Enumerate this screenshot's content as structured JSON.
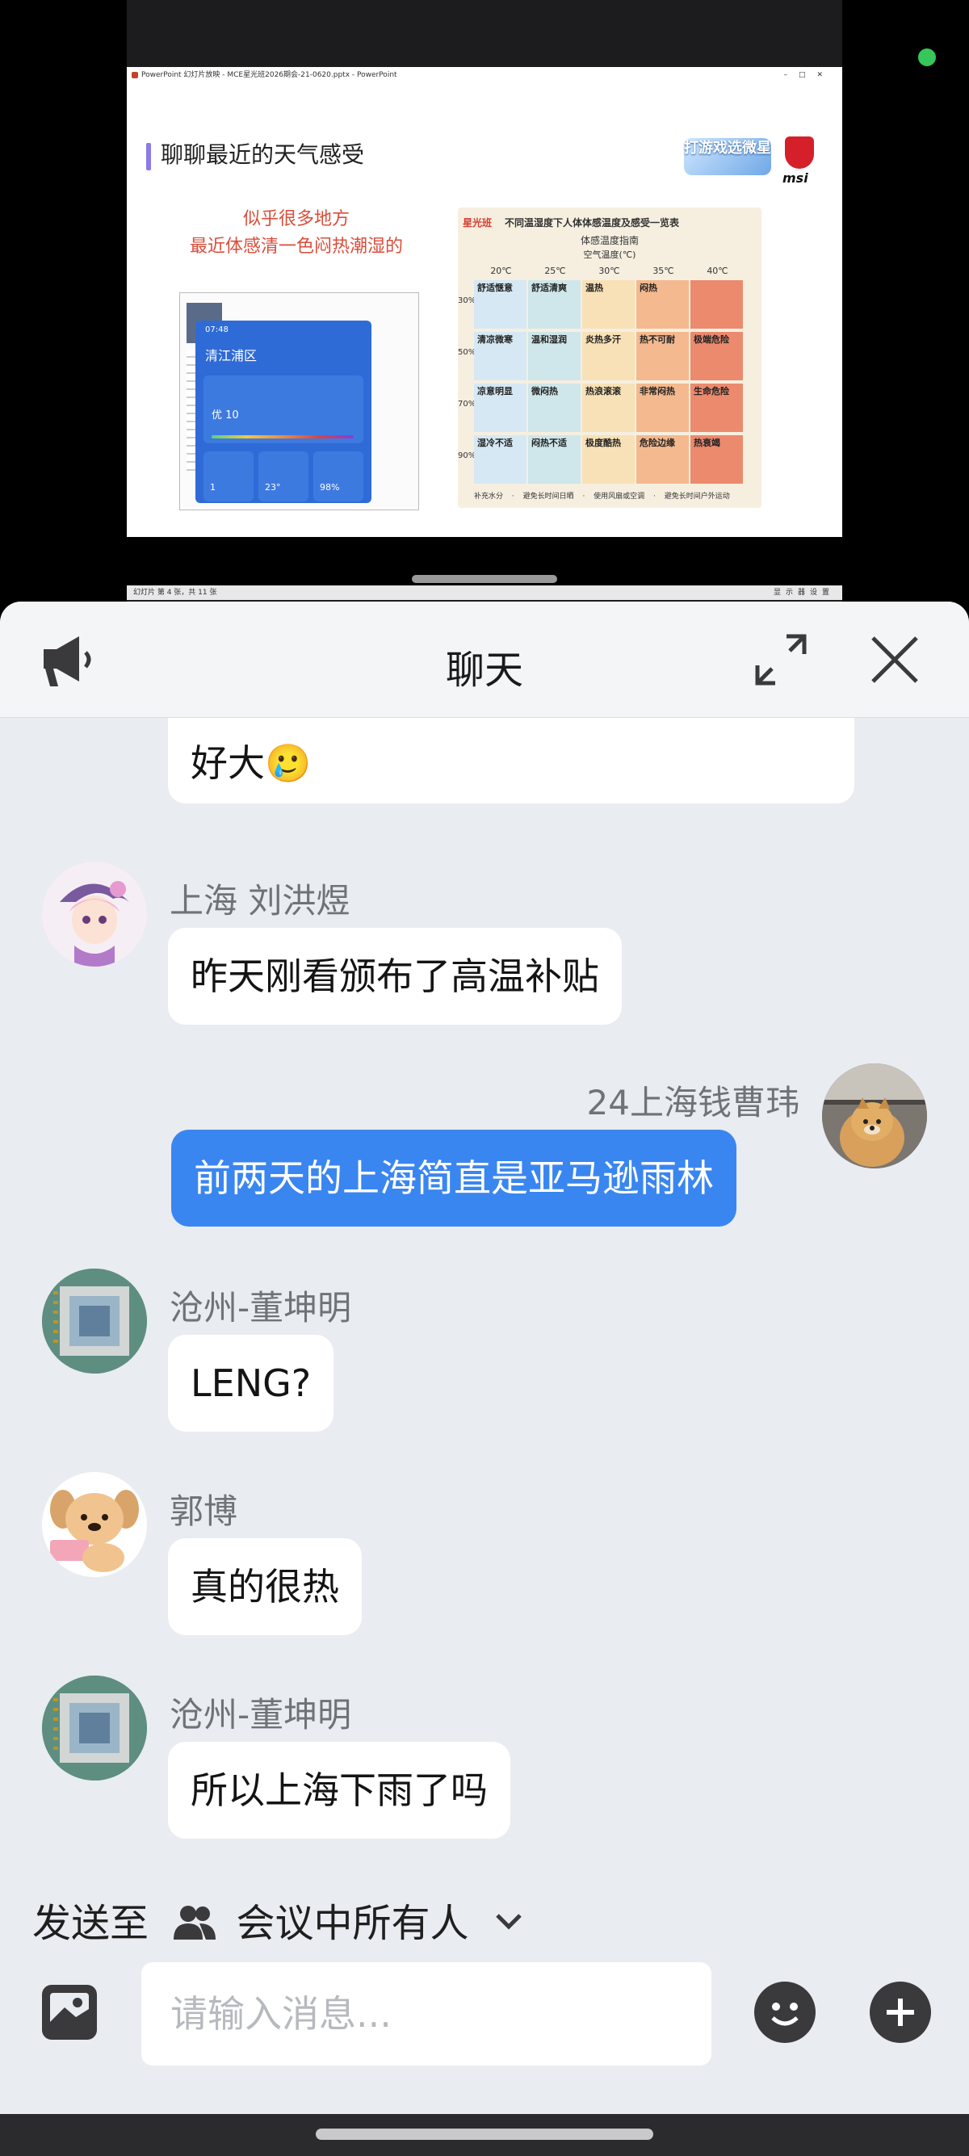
{
  "screen_share": {
    "window_title": "PowerPoint 幻灯片放映 - MCE星光班2026期会-21-0620.pptx - PowerPoint",
    "slide_title": "聊聊最近的天气感受",
    "badge_text": "打游戏选微星",
    "brand_text": "msi",
    "left_caption_line1": "似乎很多地方",
    "left_caption_line2": "最近体感清一色闷热潮湿的",
    "phone_time": "07:48",
    "phone_city": "清江浦区",
    "phone_aqi": "优 10",
    "phone_tile1": "1",
    "phone_tile2": "23°",
    "phone_tile3": "98%",
    "chart_brand": "星光班",
    "chart_title": "不同温湿度下人体体感温度及感受一览表",
    "chart_subtitle": "体感温度指南",
    "chart_axis_label": "空气温度(℃)",
    "temps": [
      "20℃",
      "25℃",
      "30℃",
      "35℃",
      "40℃"
    ],
    "humidity": [
      "30%",
      "50%",
      "70%",
      "90%"
    ],
    "cells": [
      [
        "舒适惬意",
        "舒适清爽",
        "温热",
        "闷热",
        ""
      ],
      [
        "清凉微寒",
        "温和湿润",
        "炎热多汗",
        "热不可耐",
        "极端危险"
      ],
      [
        "凉意明显",
        "微闷热",
        "热浪滚滚",
        "非常闷热",
        "生命危险"
      ],
      [
        "湿冷不适",
        "闷热不适",
        "极度酷热",
        "危险边缘",
        "热衰竭"
      ]
    ],
    "chart_footer": "补充水分 · 避免长时间日晒 · 使用风扇或空调 · 避免长时间户外运动",
    "status_left": "幻灯片 第 4 张，共 11 张",
    "status_right": "显示器设置"
  },
  "panel": {
    "title": "聊天"
  },
  "messages": [
    {
      "sender": "",
      "text": "好大🥲"
    },
    {
      "sender": "上海 刘洪煜",
      "text": "昨天刚看颁布了高温补贴"
    },
    {
      "sender": "24上海钱曹玮",
      "text": "前两天的上海简直是亚马逊雨林"
    },
    {
      "sender": "沧州-董坤明",
      "text": "LENG?"
    },
    {
      "sender": "郭博",
      "text": "真的很热"
    },
    {
      "sender": "沧州-董坤明",
      "text": "所以上海下雨了吗"
    }
  ],
  "send_to": {
    "label": "发送至",
    "target": "会议中所有人"
  },
  "composer": {
    "placeholder": "请输入消息..."
  },
  "colors": {
    "accent": "#3a86f0",
    "panel_bg": "#e9ecf1"
  }
}
